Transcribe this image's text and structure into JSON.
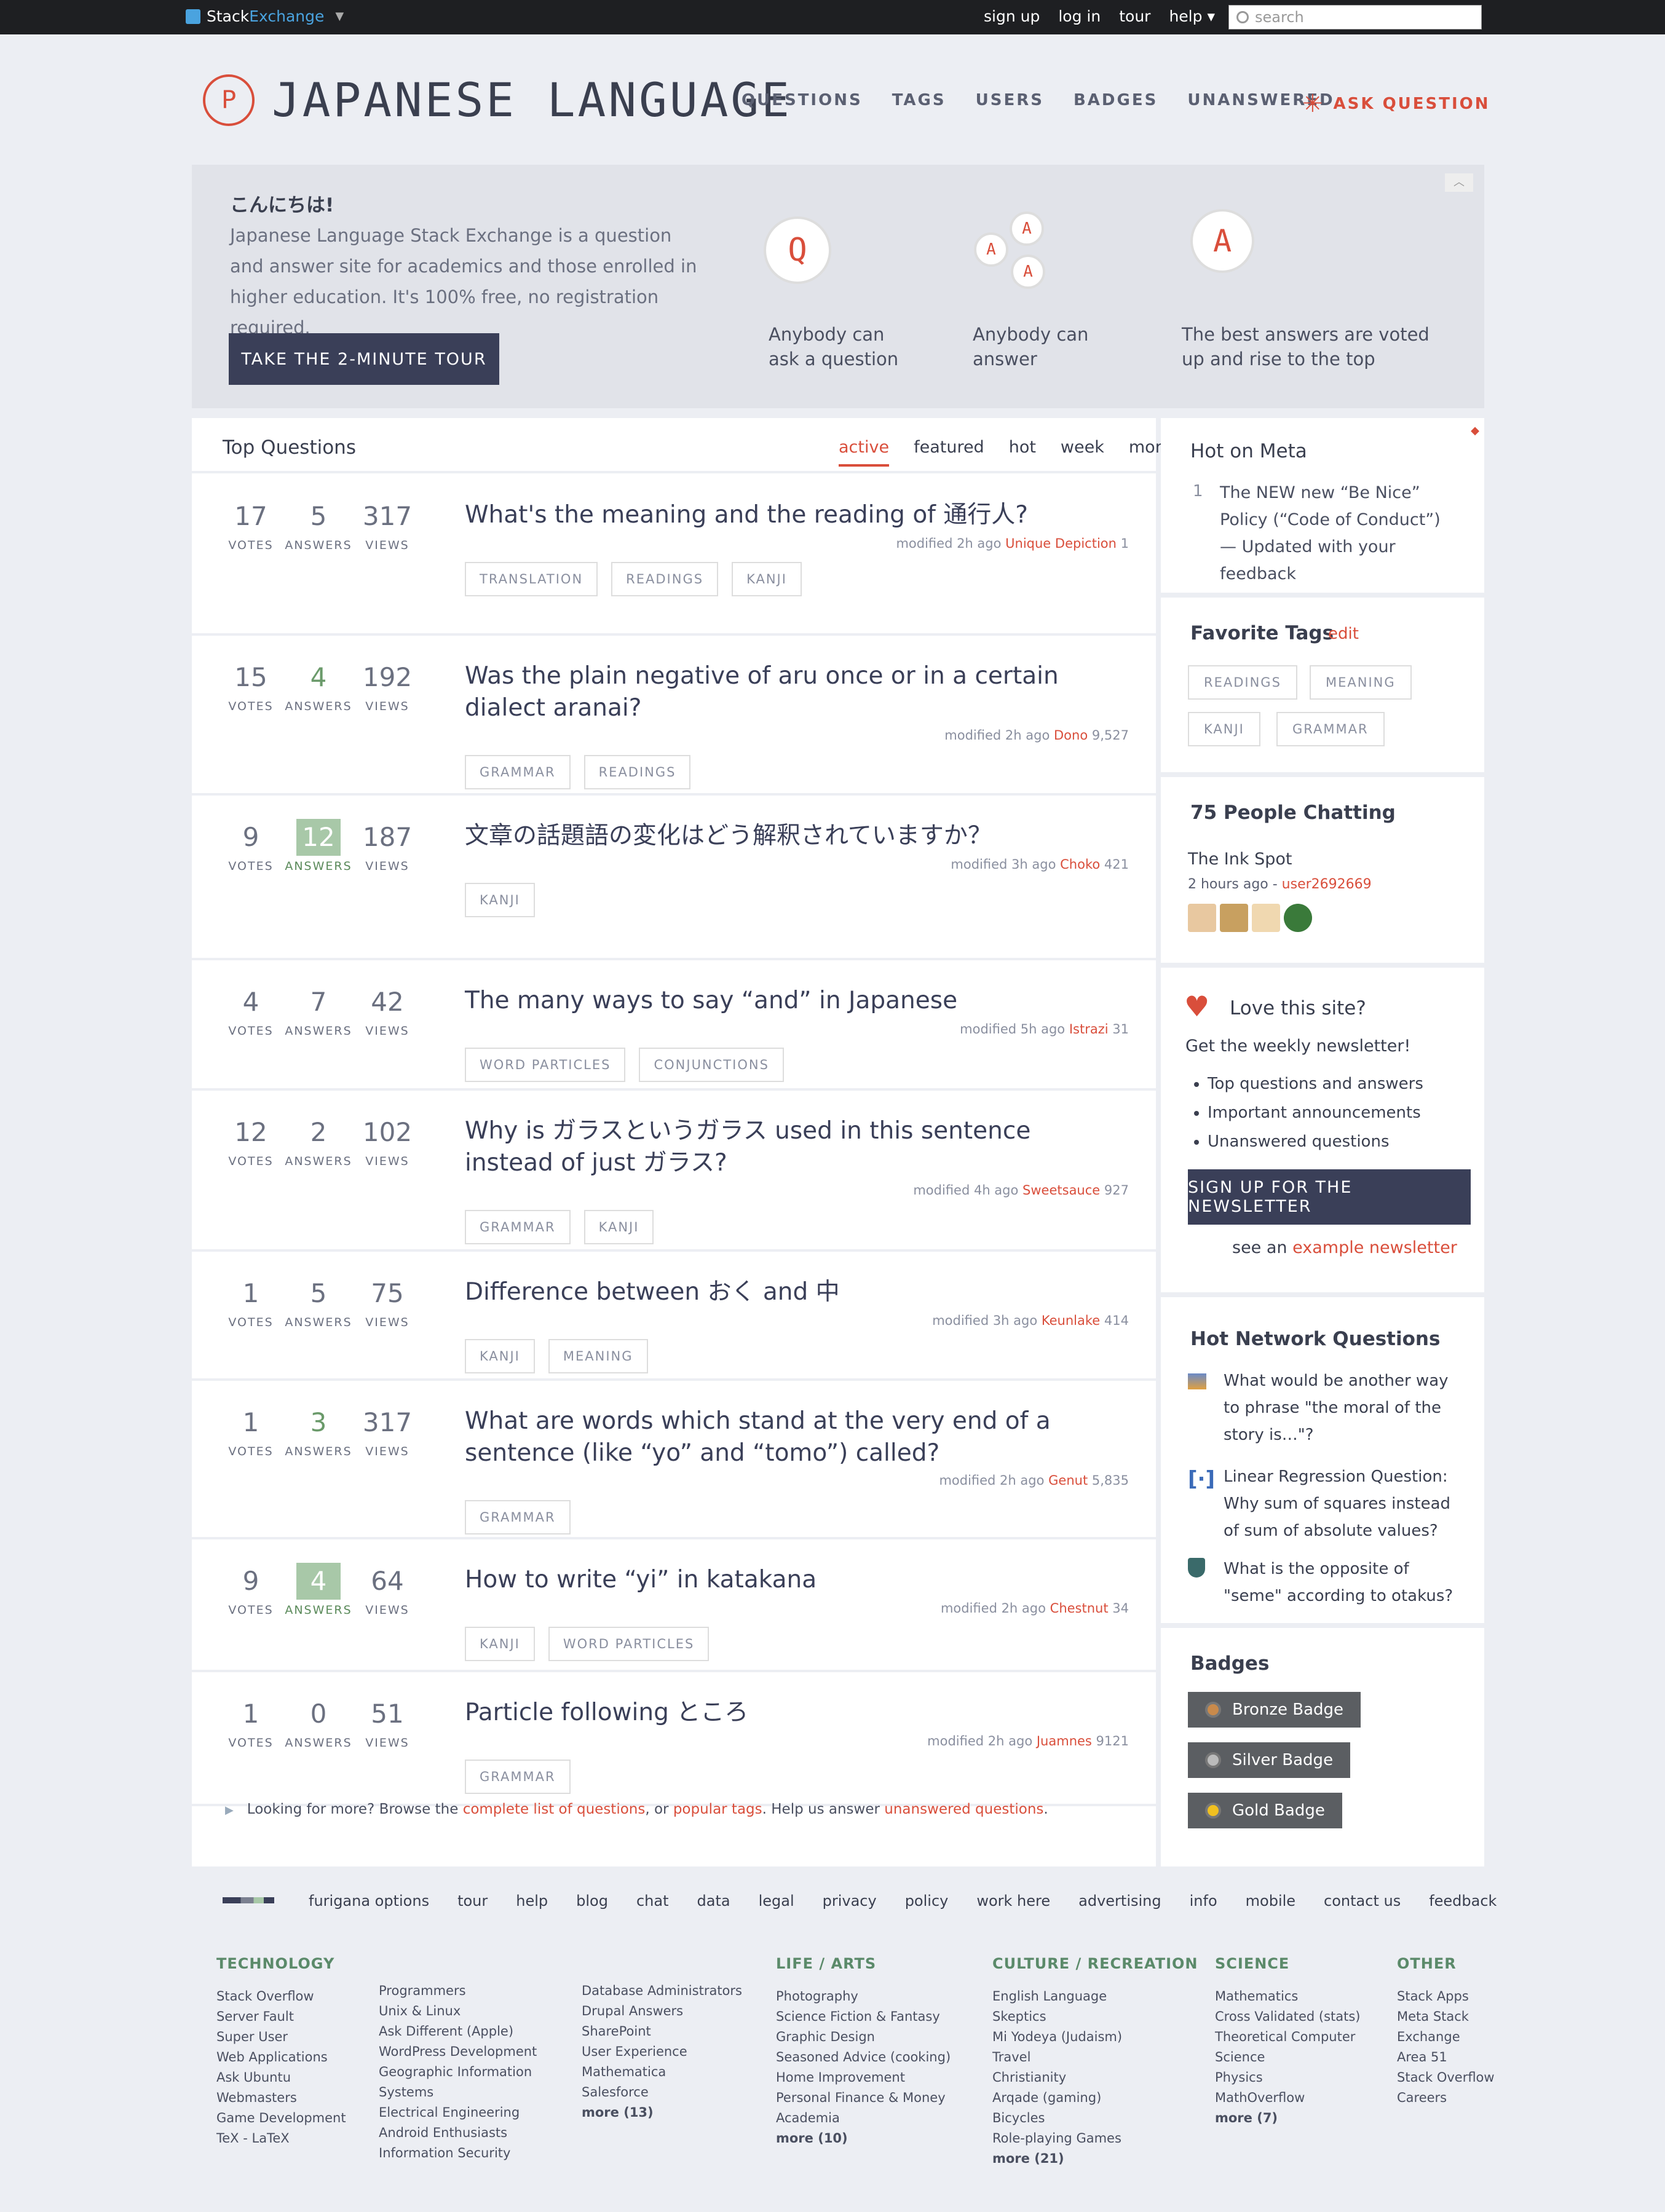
{
  "topbar": {
    "brand_a": "Stack",
    "brand_b": "Exchange",
    "links": [
      "sign up",
      "log in",
      "tour",
      "help ▾"
    ],
    "search_placeholder": "search"
  },
  "site": {
    "name": "JAPANESE LANGUAGE",
    "logo_letter": "P",
    "nav": [
      "QUESTIONS",
      "TAGS",
      "USERS",
      "BADGES",
      "UNANSWERED"
    ],
    "ask": "ASK QUESTION"
  },
  "hero": {
    "greeting": "こんにちは!",
    "text": "Japanese Language Stack Exchange is a question and answer site for academics and those enrolled in higher education. It's 100% free, no registration required.",
    "tour": "TAKE THE 2-MINUTE TOUR",
    "items": [
      "Anybody can ask a question",
      "Anybody can answer",
      "The best answers are voted up and rise to the top"
    ],
    "q_letter": "Q",
    "a_letter": "A"
  },
  "questions": {
    "heading": "Top Questions",
    "tabs": [
      "active",
      "featured",
      "hot",
      "week",
      "month"
    ],
    "labels": {
      "votes": "VOTES",
      "answers": "ANSWERS",
      "views": "VIEWS"
    },
    "rows": [
      {
        "votes": "17",
        "answers": "5",
        "views": "317",
        "title": "What's the meaning and the reading of 通行人?",
        "tags": [
          "TRANSLATION",
          "READINGS",
          "KANJI"
        ],
        "modified": "modified 2h ago",
        "user": "Unique Depiction",
        "rep": "1",
        "state": "plain"
      },
      {
        "votes": "15",
        "answers": "4",
        "views": "192",
        "title": "Was the plain negative of aru once or in a certain dialect aranai?",
        "tags": [
          "GRAMMAR",
          "READINGS"
        ],
        "modified": "modified 2h ago",
        "user": "Dono",
        "rep": "9,527",
        "state": "answered"
      },
      {
        "votes": "9",
        "answers": "12",
        "views": "187",
        "title": "文章の話題語の変化はどう解釈されていますか？",
        "tags": [
          "KANJI"
        ],
        "modified": "modified 3h ago",
        "user": "Choko",
        "rep": "421",
        "state": "accepted"
      },
      {
        "votes": "4",
        "answers": "7",
        "views": "42",
        "title": "The many ways to say “and” in Japanese",
        "tags": [
          "WORD PARTICLES",
          "CONJUNCTIONS"
        ],
        "modified": "modified 5h ago",
        "user": "Istrazi",
        "rep": "31",
        "state": "plain"
      },
      {
        "votes": "12",
        "answers": "2",
        "views": "102",
        "title": "Why is ガラスというガラス used in this sentence instead of just ガラス?",
        "tags": [
          "GRAMMAR",
          "KANJI"
        ],
        "modified": "modified 4h ago",
        "user": "Sweetsauce",
        "rep": "927",
        "state": "plain"
      },
      {
        "votes": "1",
        "answers": "5",
        "views": "75",
        "title": "Difference between おく and 中",
        "tags": [
          "KANJI",
          "MEANING"
        ],
        "modified": "modified 3h ago",
        "user": "Keunlake",
        "rep": "414",
        "state": "plain"
      },
      {
        "votes": "1",
        "answers": "3",
        "views": "317",
        "title": "What are words which stand at the very end of a sentence (like “yo” and “tomo”) called?",
        "tags": [
          "GRAMMAR"
        ],
        "modified": "modified 2h ago",
        "user": "Genut",
        "rep": "5,835",
        "state": "answered"
      },
      {
        "votes": "9",
        "answers": "4",
        "views": "64",
        "title": "How to write “yi” in katakana",
        "tags": [
          "KANJI",
          "WORD PARTICLES"
        ],
        "modified": "modified 2h ago",
        "user": "Chestnut",
        "rep": "34",
        "state": "accepted"
      },
      {
        "votes": "1",
        "answers": "0",
        "views": "51",
        "title": "Particle following ところ",
        "tags": [
          "GRAMMAR"
        ],
        "modified": "modified 2h ago",
        "user": "Juamnes",
        "rep": "9121",
        "state": "plain"
      }
    ],
    "browse": {
      "a": "Looking for more? Browse the ",
      "b": "complete list of questions",
      "c": ", or ",
      "d": "popular tags",
      "e": ". Help us answer ",
      "f": "unanswered questions",
      "g": "."
    }
  },
  "sidebar": {
    "meta": {
      "title": "Hot on Meta",
      "num": "1",
      "item": "The NEW new “Be Nice” Policy (“Code of Conduct”) — Updated with your feedback"
    },
    "fav": {
      "title": "Favorite Tags",
      "edit": "edit",
      "tags": [
        "READINGS",
        "MEANING",
        "KANJI",
        "GRAMMAR"
      ]
    },
    "chat": {
      "title": "75 People Chatting",
      "room": "The Ink Spot",
      "ago": "2 hours ago - ",
      "user": "user2692669"
    },
    "love": {
      "title": "Love this site?",
      "sub": "Get the weekly newsletter!",
      "bullets": [
        "Top questions and answers",
        "Important announcements",
        "Unanswered questions"
      ],
      "btn": "SIGN UP FOR THE NEWSLETTER",
      "see": "see an ",
      "example": "example newsletter"
    },
    "hnq": {
      "title": "Hot Network Questions",
      "items": [
        "What would be another way to phrase \"the moral of the story is…\"?",
        "Linear Regression Question: Why sum of squares instead of sum of absolute values?",
        "What is the opposite of \"seme\" according to otakus?"
      ]
    },
    "badges": {
      "title": "Badges",
      "items": [
        "Bronze Badge",
        "Silver Badge",
        "Gold Badge"
      ],
      "colors": [
        "#c98a4b",
        "#bbbbbb",
        "#f0c020"
      ]
    }
  },
  "footer": {
    "links": [
      "furigana options",
      "tour",
      "help",
      "blog",
      "chat",
      "data",
      "legal",
      "privacy",
      "policy",
      "work here",
      "advertising",
      "info",
      "mobile",
      "contact us",
      "feedback"
    ],
    "tech": {
      "title": "TECHNOLOGY",
      "c1": [
        "Stack Overflow",
        "Server Fault",
        "Super User",
        "Web Applications",
        "Ask Ubuntu",
        "Webmasters",
        "Game Development",
        "TeX - LaTeX"
      ],
      "c2": [
        "Programmers",
        "Unix & Linux",
        "Ask Different (Apple)",
        "WordPress Development",
        "Geographic Information",
        "Systems",
        "Electrical Engineering",
        "Android Enthusiasts",
        "Information Security"
      ],
      "c3": [
        "Database Administrators",
        "Drupal Answers",
        "SharePoint",
        "User Experience",
        "Mathematica",
        "Salesforce"
      ],
      "more": "more (13)"
    },
    "life": {
      "title": "LIFE / ARTS",
      "items": [
        "Photography",
        "Science Fiction & Fantasy",
        "Graphic Design",
        "Seasoned Advice (cooking)",
        "Home Improvement",
        "Personal Finance & Money",
        "Academia"
      ],
      "more": "more (10)"
    },
    "culture": {
      "title": "CULTURE / RECREATION",
      "items": [
        "English Language",
        "Skeptics",
        "Mi Yodeya (Judaism)",
        "Travel",
        "Christianity",
        "Arqade (gaming)",
        "Bicycles",
        "Role-playing Games"
      ],
      "more": "more (21)"
    },
    "science": {
      "title": "SCIENCE",
      "items": [
        "Mathematics",
        "Cross Validated (stats)",
        "Theoretical Computer",
        "Science",
        "Physics",
        "MathOverflow"
      ],
      "more": "more (7)"
    },
    "other": {
      "title": "OTHER",
      "items": [
        "Stack Apps",
        "Meta Stack",
        "Exchange",
        "Area 51",
        "Stack Overflow",
        "Careers"
      ]
    }
  }
}
